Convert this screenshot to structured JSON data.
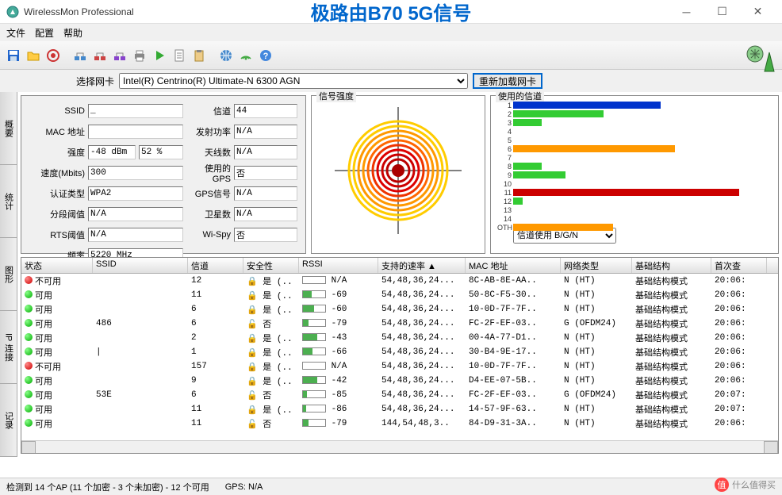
{
  "window": {
    "title": "WirelessMon Professional",
    "overlay_title": "极路由B70 5G信号"
  },
  "menu": {
    "file": "文件",
    "config": "配置",
    "help": "帮助"
  },
  "nic": {
    "label": "选择网卡",
    "value": "Intel(R) Centrino(R) Ultimate-N 6300 AGN",
    "reload": "重新加载网卡"
  },
  "vtabs": [
    "概要",
    "统计",
    "图形",
    "IP 连接",
    "记录"
  ],
  "info": {
    "ssid_label": "SSID",
    "ssid": "_",
    "channel_label": "信道",
    "channel": "44",
    "mac_label": "MAC 地址",
    "mac": "",
    "txpower_label": "发射功率",
    "txpower": "N/A",
    "strength_label": "强度",
    "strength_dbm": "-48 dBm",
    "strength_pct": "52 %",
    "antenna_label": "天线数",
    "antenna": "N/A",
    "speed_label": "速度(Mbits)",
    "speed": "300",
    "gps_used_label": "使用的GPS",
    "gps_used": "否",
    "auth_label": "认证类型",
    "auth": "WPA2",
    "gps_signal_label": "GPS信号",
    "gps_signal": "N/A",
    "frag_label": "分段阈值",
    "frag": "N/A",
    "sat_label": "卫星数",
    "sat": "N/A",
    "rts_label": "RTS阈值",
    "rts": "N/A",
    "wispy_label": "Wi-Spy",
    "wispy": "否",
    "freq_label": "频率",
    "freq": "5220 MHz"
  },
  "signal_title": "信号强度",
  "channels_title": "使用的信道",
  "channel_select": "信道使用 B/G/N",
  "chart_data": {
    "type": "bar",
    "orientation": "horizontal",
    "categories": [
      1,
      2,
      3,
      4,
      5,
      6,
      7,
      8,
      9,
      10,
      11,
      12,
      13,
      14,
      "OTH"
    ],
    "values": [
      62,
      38,
      12,
      0,
      0,
      68,
      0,
      12,
      22,
      0,
      95,
      4,
      0,
      0,
      42
    ],
    "colors": [
      "#0033cc",
      "#33cc33",
      "#33cc33",
      "",
      "",
      "#ff9900",
      "",
      "#33cc33",
      "#33cc33",
      "",
      "#cc0000",
      "#33cc33",
      "",
      "",
      "#ff9900"
    ],
    "xlabel": "",
    "ylabel": "信道",
    "xlim": [
      0,
      100
    ]
  },
  "grid": {
    "headers": [
      "状态",
      "SSID",
      "信道",
      "安全性",
      "RSSI",
      "支持的速率",
      "MAC 地址",
      "网络类型",
      "基础结构",
      "首次查"
    ],
    "sort_col": 5,
    "rows": [
      {
        "status": "不可用",
        "dot": "red",
        "ssid": "",
        "ch": "12",
        "sec": "是 (..",
        "locked": true,
        "rssi": "N/A",
        "rssi_pct": 0,
        "rates": "54,48,36,24...",
        "mac": "8C-AB-8E-AA..",
        "net": "N (HT)",
        "infra": "基础结构模式",
        "first": "20:06:"
      },
      {
        "status": "可用",
        "dot": "green",
        "ssid": "",
        "ch": "11",
        "sec": "是 (..",
        "locked": true,
        "rssi": "-69",
        "rssi_pct": 40,
        "rates": "54,48,36,24...",
        "mac": "50-8C-F5-30..",
        "net": "N (HT)",
        "infra": "基础结构模式",
        "first": "20:06:"
      },
      {
        "status": "可用",
        "dot": "green",
        "ssid": "",
        "ch": "6",
        "sec": "是 (..",
        "locked": true,
        "rssi": "-60",
        "rssi_pct": 50,
        "rates": "54,48,36,24...",
        "mac": "10-0D-7F-7F..",
        "net": "N (HT)",
        "infra": "基础结构模式",
        "first": "20:06:"
      },
      {
        "status": "可用",
        "dot": "green",
        "ssid": "486",
        "ch": "6",
        "sec": "否",
        "locked": false,
        "rssi": "-79",
        "rssi_pct": 25,
        "rates": "54,48,36,24...",
        "mac": "FC-2F-EF-03..",
        "net": "G (OFDM24)",
        "infra": "基础结构模式",
        "first": "20:06:"
      },
      {
        "status": "可用",
        "dot": "green",
        "ssid": "",
        "ch": "2",
        "sec": "是 (..",
        "locked": true,
        "rssi": "-43",
        "rssi_pct": 65,
        "rates": "54,48,36,24...",
        "mac": "00-4A-77-D1..",
        "net": "N (HT)",
        "infra": "基础结构模式",
        "first": "20:06:"
      },
      {
        "status": "可用",
        "dot": "green",
        "ssid": "|",
        "ch": "1",
        "sec": "是 (..",
        "locked": true,
        "rssi": "-66",
        "rssi_pct": 42,
        "rates": "54,48,36,24...",
        "mac": "30-B4-9E-17..",
        "net": "N (HT)",
        "infra": "基础结构模式",
        "first": "20:06:"
      },
      {
        "status": "不可用",
        "dot": "red",
        "ssid": "",
        "ch": "157",
        "sec": "是 (..",
        "locked": true,
        "rssi": "N/A",
        "rssi_pct": 0,
        "rates": "54,48,36,24...",
        "mac": "10-0D-7F-7F..",
        "net": "N (HT)",
        "infra": "基础结构模式",
        "first": "20:06:"
      },
      {
        "status": "可用",
        "dot": "green",
        "ssid": "",
        "ch": "9",
        "sec": "是 (..",
        "locked": true,
        "rssi": "-42",
        "rssi_pct": 65,
        "rates": "54,48,36,24...",
        "mac": "D4-EE-07-5B..",
        "net": "N (HT)",
        "infra": "基础结构模式",
        "first": "20:06:"
      },
      {
        "status": "可用",
        "dot": "green",
        "ssid": "53E",
        "ch": "6",
        "sec": "否",
        "locked": false,
        "rssi": "-85",
        "rssi_pct": 18,
        "rates": "54,48,36,24...",
        "mac": "FC-2F-EF-03..",
        "net": "G (OFDM24)",
        "infra": "基础结构模式",
        "first": "20:07:"
      },
      {
        "status": "可用",
        "dot": "green",
        "ssid": "",
        "ch": "11",
        "sec": "是 (..",
        "locked": true,
        "rssi": "-86",
        "rssi_pct": 16,
        "rates": "54,48,36,24...",
        "mac": "14-57-9F-63..",
        "net": "N (HT)",
        "infra": "基础结构模式",
        "first": "20:07:"
      },
      {
        "status": "可用",
        "dot": "green",
        "ssid": "",
        "ch": "11",
        "sec": "否",
        "locked": false,
        "rssi": "-79",
        "rssi_pct": 25,
        "rates": "144,54,48,3..",
        "mac": "84-D9-31-3A..",
        "net": "N (HT)",
        "infra": "基础结构模式",
        "first": "20:06:"
      }
    ]
  },
  "statusbar": {
    "ap_count": "检测到 14 个AP (11 个加密 - 3 个未加密) - 12 个可用",
    "gps": "GPS: N/A"
  },
  "watermark": "什么值得买"
}
